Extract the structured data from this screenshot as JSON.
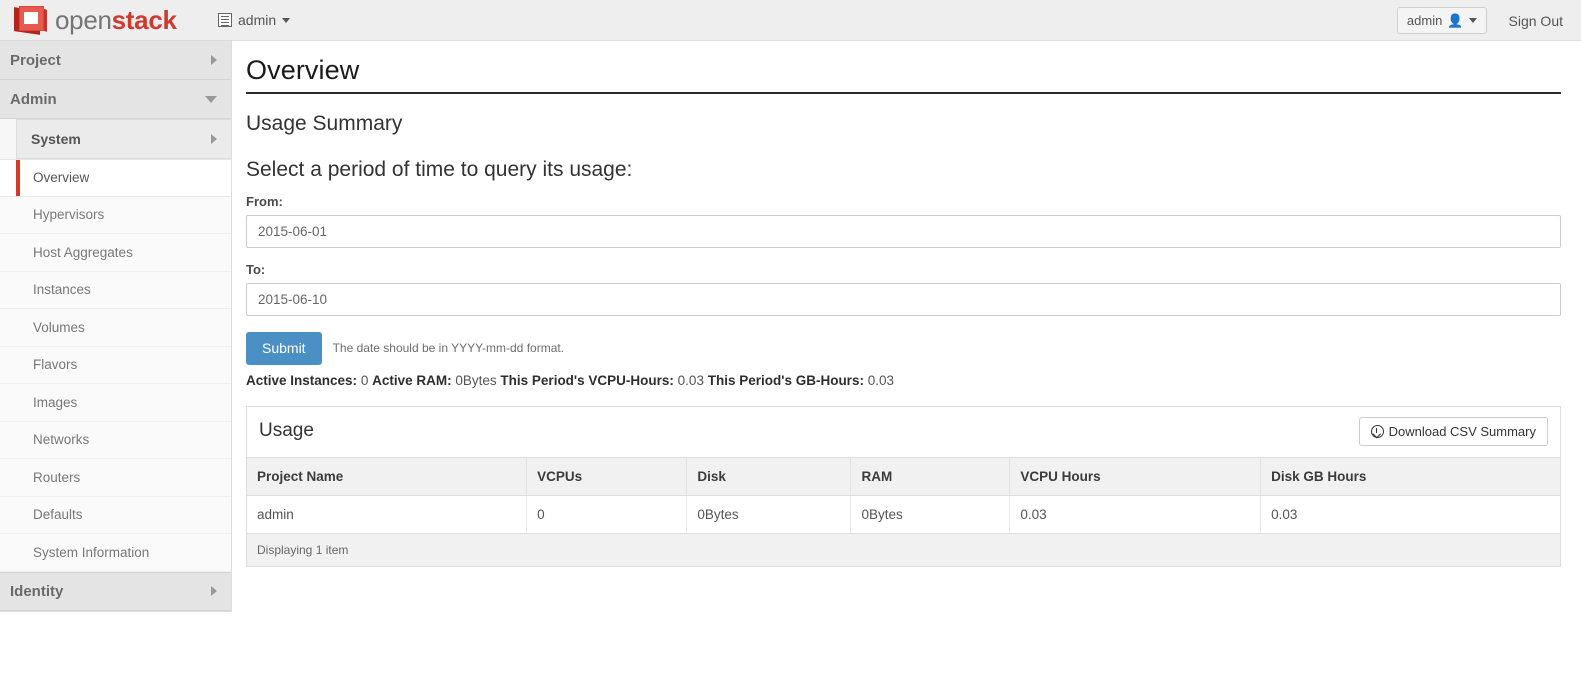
{
  "navbar": {
    "brand_open": "open",
    "brand_stack": "stack",
    "context_switcher_label": "admin",
    "context_icon": "list-box-icon",
    "user_menu_label": "admin",
    "user_icon": "person-icon",
    "sign_out_label": "Sign Out"
  },
  "sidebar": {
    "panels": [
      {
        "label": "Project",
        "expanded": false,
        "icon": "chevron-right-icon"
      },
      {
        "label": "Admin",
        "expanded": true,
        "icon": "chevron-down-icon"
      },
      {
        "label": "Identity",
        "expanded": false,
        "icon": "chevron-right-icon"
      }
    ],
    "group_label": "System",
    "group_icon": "chevron-right-icon",
    "items": [
      {
        "label": "Overview",
        "active": true
      },
      {
        "label": "Hypervisors",
        "active": false
      },
      {
        "label": "Host Aggregates",
        "active": false
      },
      {
        "label": "Instances",
        "active": false
      },
      {
        "label": "Volumes",
        "active": false
      },
      {
        "label": "Flavors",
        "active": false
      },
      {
        "label": "Images",
        "active": false
      },
      {
        "label": "Networks",
        "active": false
      },
      {
        "label": "Routers",
        "active": false
      },
      {
        "label": "Defaults",
        "active": false
      },
      {
        "label": "System Information",
        "active": false
      }
    ]
  },
  "main": {
    "page_title": "Overview",
    "section_title": "Usage Summary",
    "form_legend": "Select a period of time to query its usage:",
    "from_label": "From:",
    "from_value": "2015-06-01",
    "to_label": "To:",
    "to_value": "2015-06-10",
    "submit_label": "Submit",
    "help_text": "The date should be in YYYY-mm-dd format.",
    "stats": {
      "active_instances_label": "Active Instances:",
      "active_instances_value": "0",
      "active_ram_label": "Active RAM:",
      "active_ram_value": "0Bytes",
      "vcpu_hours_label": "This Period's VCPU-Hours:",
      "vcpu_hours_value": "0.03",
      "gb_hours_label": "This Period's GB-Hours:",
      "gb_hours_value": "0.03"
    }
  },
  "usage_table": {
    "title": "Usage",
    "download_button_label": "Download CSV Summary",
    "download_icon": "download-circle-icon",
    "columns": [
      "Project Name",
      "VCPUs",
      "Disk",
      "RAM",
      "VCPU Hours",
      "Disk GB Hours"
    ],
    "rows": [
      [
        "admin",
        "0",
        "0Bytes",
        "0Bytes",
        "0.03",
        "0.03"
      ]
    ],
    "footer": "Displaying 1 item"
  },
  "colors": {
    "brand_red": "#cc3a30",
    "active_marker": "#cf3a2c",
    "primary_button": "#4a90c4",
    "navbar_bg": "#eeeeee",
    "sidebar_bg": "#f7f7f7"
  }
}
